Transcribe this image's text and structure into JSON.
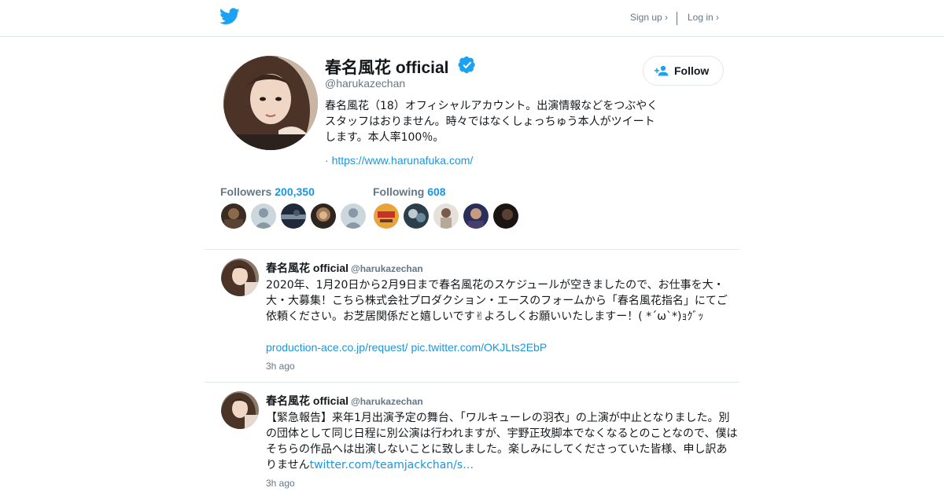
{
  "header": {
    "signup_label": "Sign up ›",
    "login_label": "Log in ›",
    "logo_icon": "twitter-bird-icon",
    "brand_color": "#1da1f2"
  },
  "profile": {
    "name": "春名風花 official",
    "handle": "@harukazechan",
    "verified_icon": "verified-badge-icon",
    "bio": "春名風花（18）オフィシャルアカウント。出演情報などをつぶやくスタッフはおりません。時々ではなくしょっちゅう本人がツイートします。本人率100％。",
    "link_prefix": "·",
    "link": "https://www.harunafuka.com/",
    "follow_label": "Follow",
    "follow_icon": "add-user-icon"
  },
  "stats": {
    "followers_label": "Followers",
    "followers_count": "200,350",
    "following_label": "Following",
    "following_count": "608"
  },
  "tweets": [
    {
      "name": "春名風花 official",
      "handle": "@harukazechan",
      "text": "2020年、1月20日から2月9日まで春名風花のスケジュールが空きましたので、お仕事を大・大・大募集！こちら株式会社プロダクション・エースのフォームから「春名風花指名」にてご依頼ください。お芝居関係だと嬉しいです✌よろしくお願いいたしますー！( *´ω`*)ｮｸﾞｯ",
      "link1": "production-ace.co.jp/request/",
      "link2": "pic.twitter.com/OKJLts2EbP",
      "time": "3h ago"
    },
    {
      "name": "春名風花 official",
      "handle": "@harukazechan",
      "text": "【緊急報告】来年1月出演予定の舞台、「ワルキューレの羽衣」の上演が中止となりました。別の団体として同じ日程に別公演は行われますが、宇野正玫脚本でなくなるとのことなので、僕はそちらの作品へは出演しないことに致しました。楽しみにしてくださっていた皆様、申し訳ありません",
      "link1": "twitter.com/teamjackchan/s…",
      "time": "3h ago"
    }
  ]
}
